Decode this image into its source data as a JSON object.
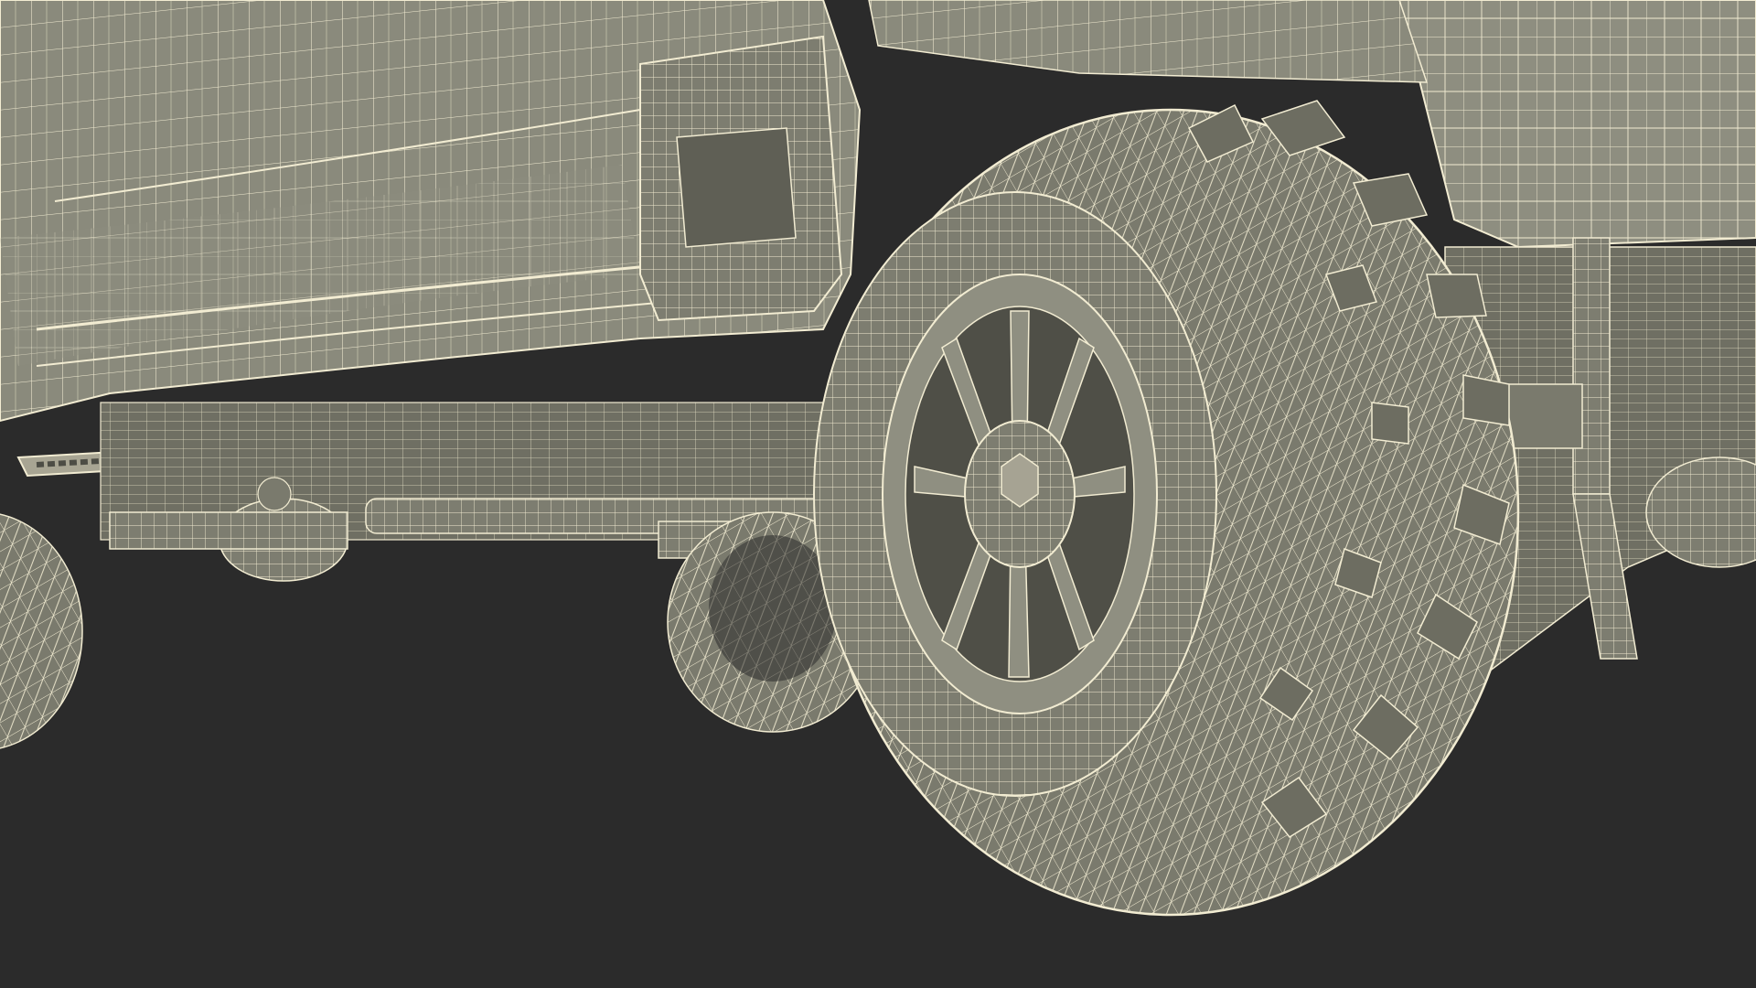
{
  "scene": {
    "background_color": "#2b2b2b",
    "surface_color": "#858577",
    "surface_light_color": "#9a9a8b",
    "surface_dark_color": "#5f5f55",
    "wire_color": "#f2ecd2",
    "subject": "wireframe-render-of-truck-wheel-and-undercarriage"
  }
}
